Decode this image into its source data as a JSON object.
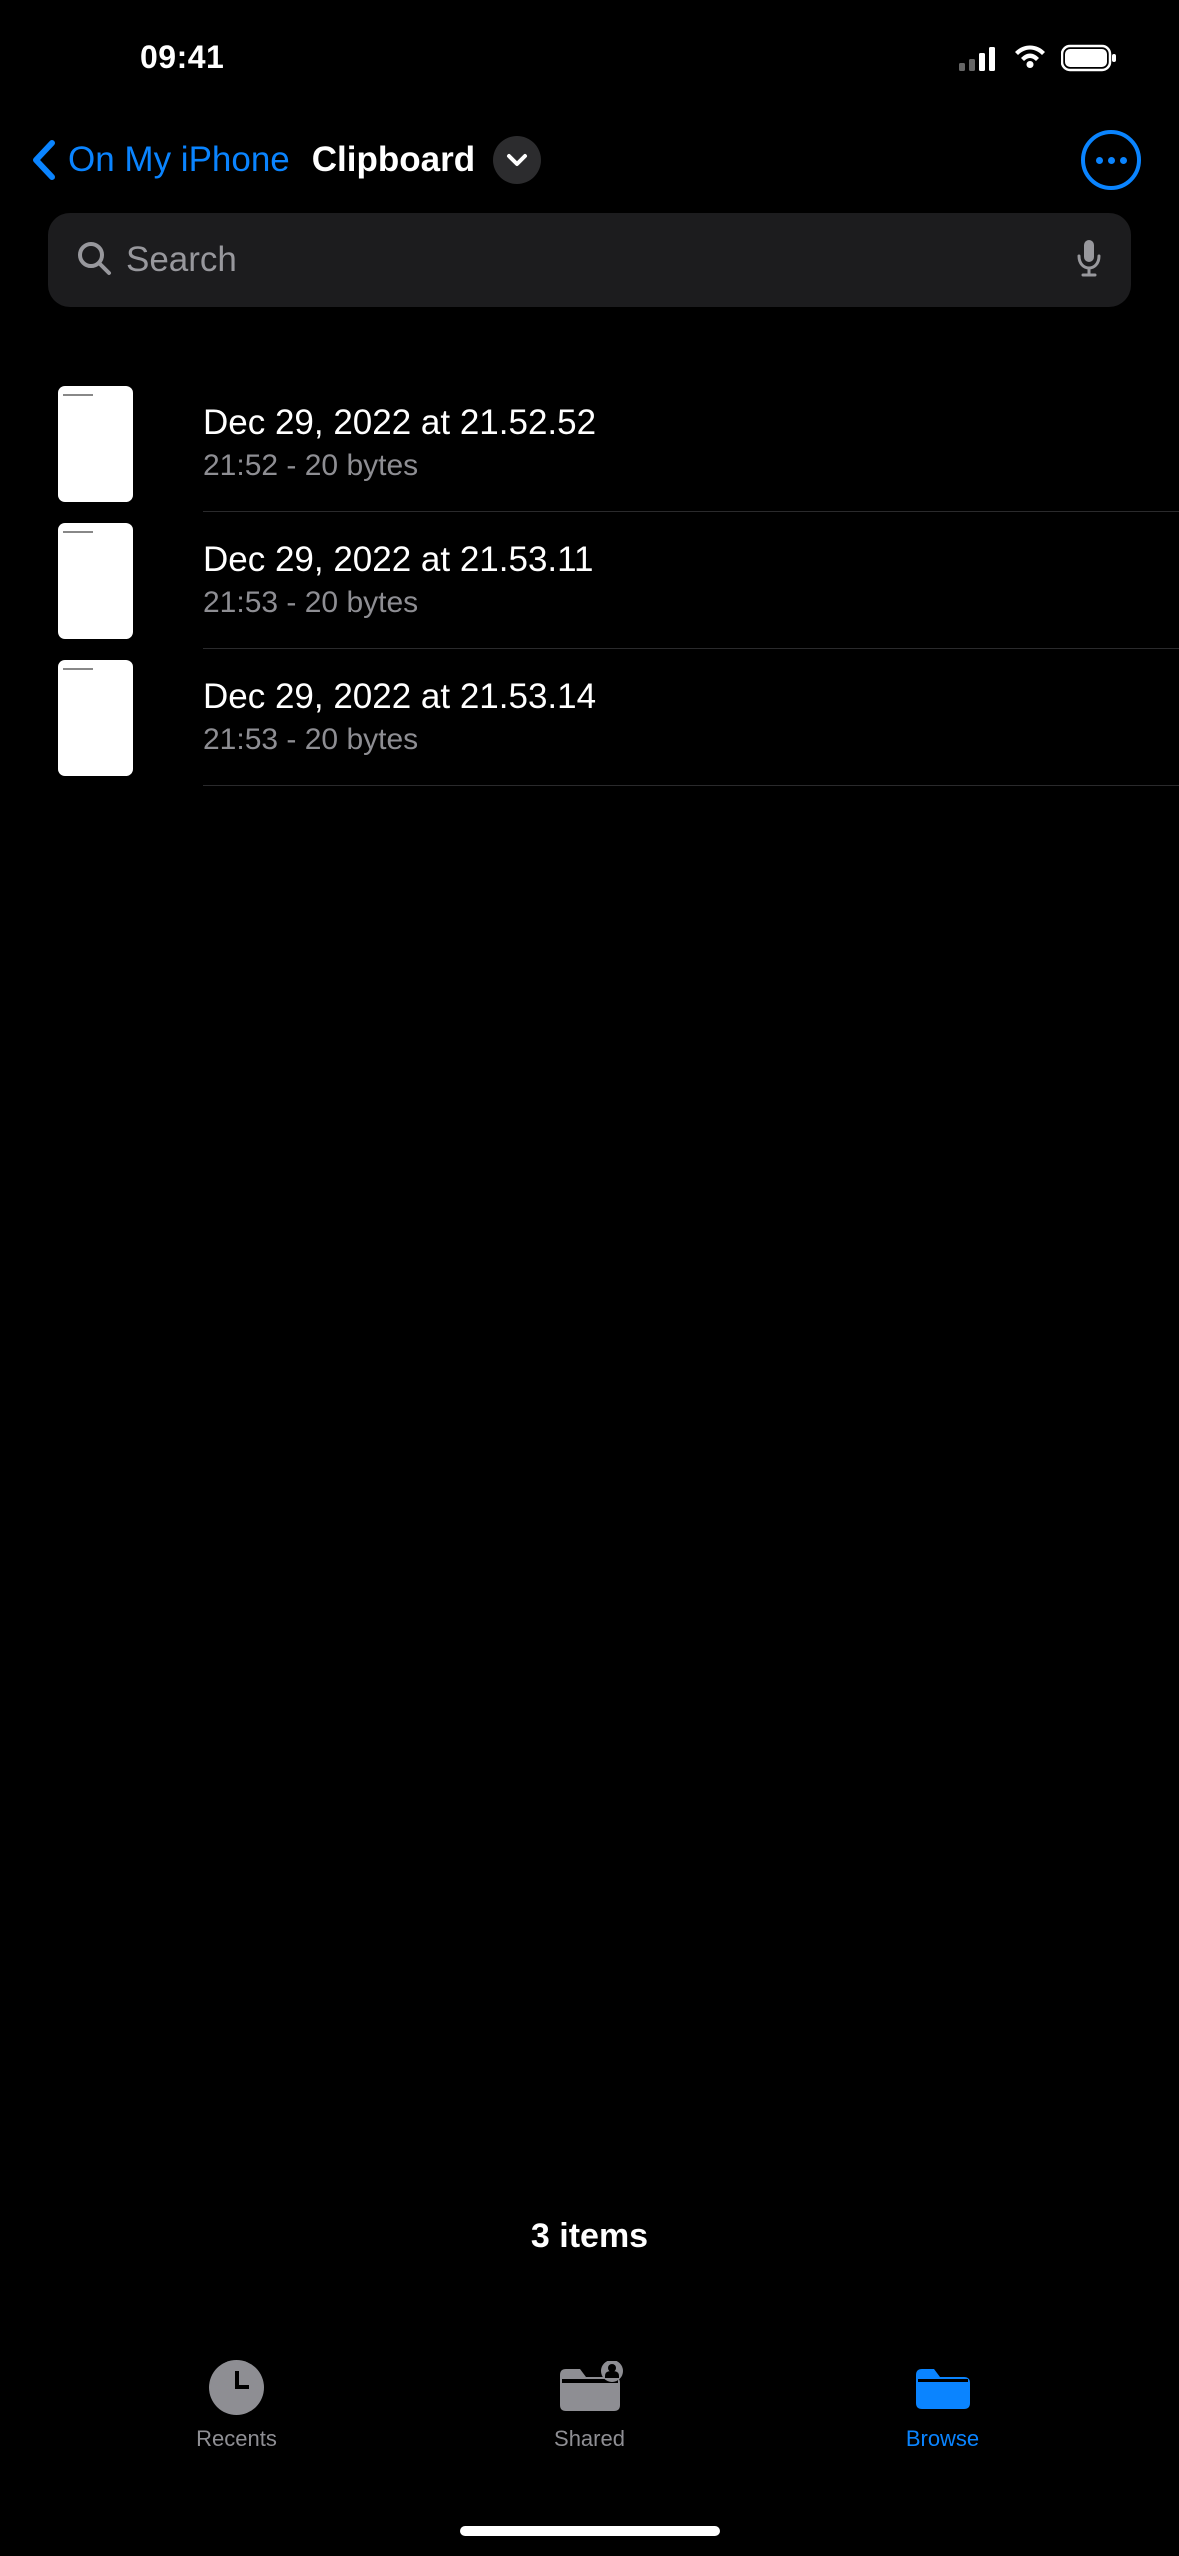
{
  "status": {
    "time": "09:41"
  },
  "nav": {
    "back_label": "On My iPhone",
    "title": "Clipboard"
  },
  "search": {
    "placeholder": "Search"
  },
  "files": [
    {
      "name": "Dec 29, 2022 at 21.52.52",
      "meta": "21:52 - 20 bytes"
    },
    {
      "name": "Dec 29, 2022 at 21.53.11",
      "meta": "21:53 - 20 bytes"
    },
    {
      "name": "Dec 29, 2022 at 21.53.14",
      "meta": "21:53 - 20 bytes"
    }
  ],
  "footer": {
    "count": "3 items"
  },
  "tabs": {
    "recents": "Recents",
    "shared": "Shared",
    "browse": "Browse"
  }
}
